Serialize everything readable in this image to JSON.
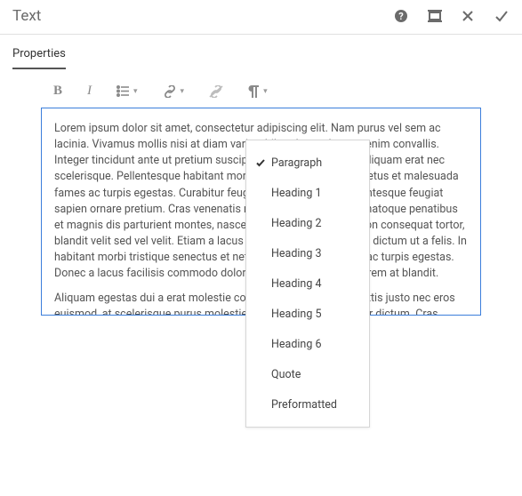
{
  "header": {
    "title": "Text"
  },
  "tabs": {
    "properties": "Properties"
  },
  "toolbar": {
    "bold": "B",
    "italic": "I"
  },
  "editor": {
    "p1": "Lorem ipsum dolor sit amet, consectetur adipiscing elit. Nam purus vel sem ac lacinia. Vivamus mollis nisi at diam varius, bibendum vulputate enim convallis. Integer tincidunt ante ut pretium suscipit. Pellentesque aliquet aliquam erat nec scelerisque. Pellentesque habitant morbi tristique senectus et netus et malesuada fames ac turpis egestas. Curabitur feugiat rutrum sagittis. Pellentesque feugiat sapien ornare pretium. Cras venenatis neque lorem. Orci varius natoque penatibus et magnis dis parturient montes, nascetur ridiculus mus. Duis non consequat tortor, blandit velit sed vel velit. Etiam a lacus sit amet libero commodo dictum ut a felis. In habitant morbi tristique senectus et netus et malesuada fames ac turpis egestas. Donec a lacus facilisis commodo dolor. Duis eleifend facilisis lorem at blandit.",
    "p2": "Aliquam egestas dui a erat molestie condimentum. Quisque mattis justo nec eros euismod, at scelerisque purus molestie. Vestibulum rutrum dolor dictum. Cras pretium"
  },
  "dropdown": {
    "items": [
      {
        "label": "Paragraph",
        "selected": true
      },
      {
        "label": "Heading 1",
        "selected": false
      },
      {
        "label": "Heading 2",
        "selected": false
      },
      {
        "label": "Heading 3",
        "selected": false
      },
      {
        "label": "Heading 4",
        "selected": false
      },
      {
        "label": "Heading 5",
        "selected": false
      },
      {
        "label": "Heading 6",
        "selected": false
      },
      {
        "label": "Quote",
        "selected": false
      },
      {
        "label": "Preformatted",
        "selected": false
      }
    ]
  }
}
